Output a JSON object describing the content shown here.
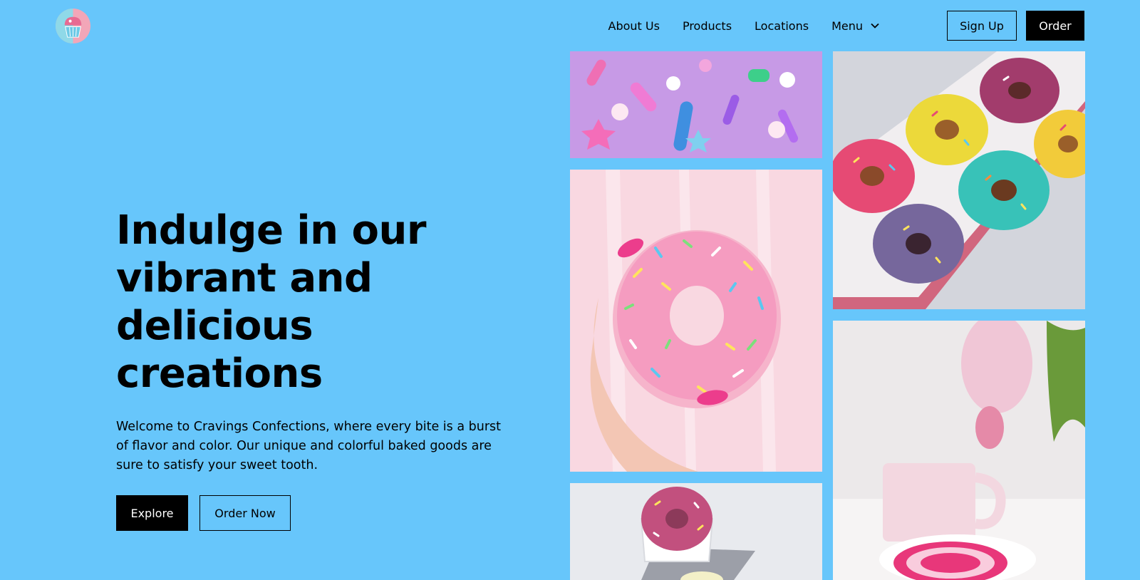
{
  "brand": {
    "logo_icon": "cupcake-icon"
  },
  "nav": {
    "links": [
      "About Us",
      "Products",
      "Locations"
    ],
    "menu_label": "Menu",
    "menu_icon": "chevron-down-icon",
    "signup_label": "Sign Up",
    "order_label": "Order"
  },
  "hero": {
    "title": "Indulge in our vibrant and delicious creations",
    "description": "Welcome to Cravings Confections, where every bite is a burst of flavor and color. Our unique and colorful baked goods are sure to satisfy your sweet tooth.",
    "explore_label": "Explore",
    "order_now_label": "Order Now"
  },
  "colors": {
    "background": "#67c6fb",
    "primary_button": "#000000",
    "primary_text": "#ffffff"
  }
}
